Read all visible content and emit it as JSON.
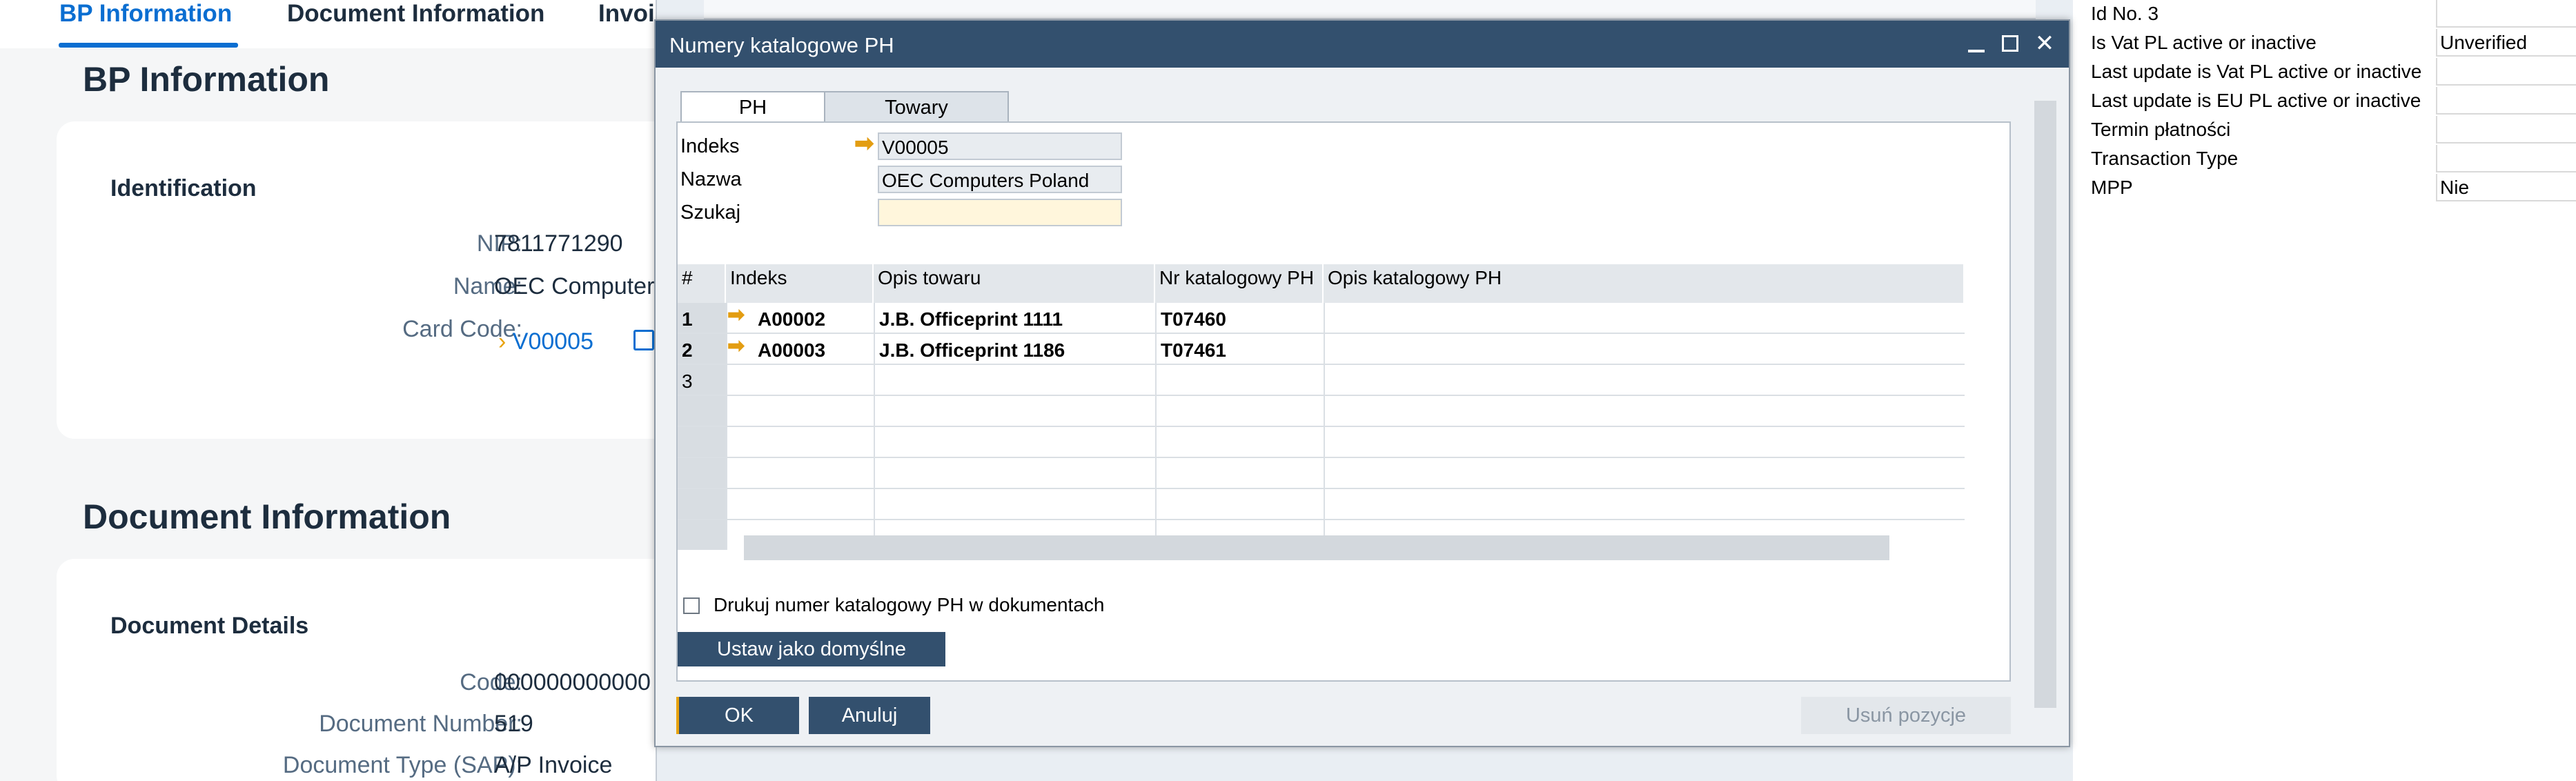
{
  "background": {
    "tabs": [
      "BP Information",
      "Document Information",
      "Invoice"
    ],
    "bp_section_title": "BP Information",
    "identification_title": "Identification",
    "nip_label": "NIP:",
    "nip_value": "7811771290",
    "name_label": "Name:",
    "name_value": "OEC Computer",
    "card_code_label": "Card Code:",
    "card_code_value": "V00005",
    "doc_section_title": "Document Information",
    "doc_details_title": "Document Details",
    "code_label": "Code:",
    "code_value": "000000000000",
    "doc_number_label": "Document Number:",
    "doc_number_value": "519",
    "doc_type_label": "Document Type (SAP):",
    "doc_type_value": "A/P Invoice"
  },
  "properties": [
    {
      "label": "Id No. 3",
      "value": ""
    },
    {
      "label": "Is Vat PL active or inactive",
      "value": "Unverified"
    },
    {
      "label": "Last update is Vat PL active or inactive",
      "value": ""
    },
    {
      "label": "Last update is EU PL active or inactive",
      "value": ""
    },
    {
      "label": "Termin płatności",
      "value": ""
    },
    {
      "label": "Transaction Type",
      "value": ""
    },
    {
      "label": "MPP",
      "value": "Nie"
    }
  ],
  "dialog": {
    "title": "Numery katalogowe PH",
    "tabs": [
      "PH",
      "Towary"
    ],
    "indeks_label": "Indeks",
    "indeks_value": "V00005",
    "nazwa_label": "Nazwa",
    "nazwa_value": "OEC Computers Poland",
    "szukaj_label": "Szukaj",
    "szukaj_value": "",
    "grid_headers": [
      "#",
      "Indeks",
      "Opis towaru",
      "Nr katalogowy PH",
      "Opis katalogowy PH"
    ],
    "rows": [
      {
        "num": "1",
        "indeks": "A00002",
        "opis": "J.B. Officeprint 1111",
        "nr": "T07460",
        "opis_kat": ""
      },
      {
        "num": "2",
        "indeks": "A00003",
        "opis": "J.B. Officeprint 1186",
        "nr": "T07461",
        "opis_kat": ""
      },
      {
        "num": "3",
        "indeks": "",
        "opis": "",
        "nr": "",
        "opis_kat": ""
      }
    ],
    "print_checkbox_label": "Drukuj numer katalogowy PH w dokumentach",
    "set_default_button": "Ustaw jako domyślne",
    "ok_button": "OK",
    "cancel_button": "Anuluj",
    "remove_button": "Usuń pozycje"
  },
  "colors": {
    "accent_blue": "#0a6ed1",
    "titlebar": "#33506e",
    "link_arrow": "#e39d12"
  }
}
